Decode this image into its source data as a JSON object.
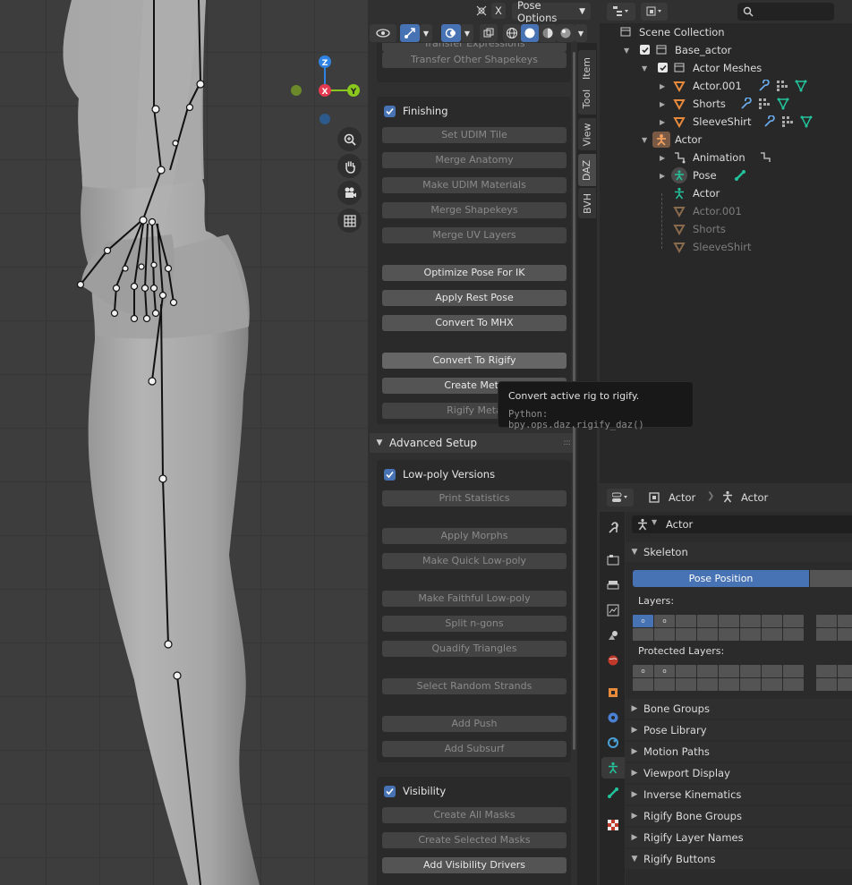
{
  "header": {
    "mode_options_label": "Pose Options",
    "x_label": "X"
  },
  "sidebar_tabs": [
    "Item",
    "Tool",
    "View",
    "DAZ",
    "BVH"
  ],
  "sidebar": {
    "top_buttons": [
      "Transfer Expressions",
      "Transfer Other Shapekeys"
    ],
    "finishing": {
      "title": "Finishing",
      "buttons": [
        "Set UDIM Tile",
        "Merge Anatomy",
        "Make UDIM Materials",
        "Merge Shapekeys",
        "Merge UV Layers",
        "Optimize Pose For IK",
        "Apply Rest Pose",
        "Convert To MHX",
        "Convert To Rigify",
        "Create Meta",
        "Rigify Meta"
      ]
    },
    "advanced_setup": {
      "title": "Advanced Setup"
    },
    "lowpoly": {
      "title": "Low-poly Versions",
      "buttons": [
        "Print Statistics",
        "Apply Morphs",
        "Make Quick Low-poly",
        "Make Faithful Low-poly",
        "Split n-gons",
        "Quadify Triangles",
        "Select Random Strands",
        "Add Push",
        "Add Subsurf"
      ]
    },
    "visibility": {
      "title": "Visibility",
      "buttons": [
        "Create All Masks",
        "Create Selected Masks",
        "Add Visibility Drivers"
      ]
    }
  },
  "tooltip": {
    "description": "Convert active rig to rigify.",
    "python": "Python: bpy.ops.daz.rigify_daz()"
  },
  "gizmo": {
    "z": "Z",
    "x": "X",
    "y": "Y"
  },
  "outliner": {
    "rows": [
      {
        "label": "Scene Collection"
      },
      {
        "label": "Base_actor"
      },
      {
        "label": "Actor Meshes"
      },
      {
        "label": "Actor.001"
      },
      {
        "label": "Shorts"
      },
      {
        "label": "SleeveShirt"
      },
      {
        "label": "Actor"
      },
      {
        "label": "Animation"
      },
      {
        "label": "Pose"
      },
      {
        "label": "Actor"
      },
      {
        "label": "Actor.001"
      },
      {
        "label": "Shorts"
      },
      {
        "label": "SleeveShirt"
      }
    ]
  },
  "properties": {
    "breadcrumb_object": "Actor",
    "breadcrumb_data": "Actor",
    "data_name": "Actor",
    "skeleton_title": "Skeleton",
    "pose_position_label": "Pose Position",
    "layers_label": "Layers:",
    "protected_layers_label": "Protected Layers:",
    "subpanels": [
      "Bone Groups",
      "Pose Library",
      "Motion Paths",
      "Viewport Display",
      "Inverse Kinematics",
      "Rigify Bone Groups",
      "Rigify Layer Names",
      "Rigify Buttons"
    ]
  },
  "colors": {
    "accent_blue": "#4772b3",
    "gizmo_z": "#2f83e3",
    "gizmo_x": "#e33a50",
    "gizmo_y": "#8ac81e",
    "mesh_orange": "#e88a3c",
    "modifier_blue": "#6aa9e8",
    "data_green": "#22c29a"
  }
}
